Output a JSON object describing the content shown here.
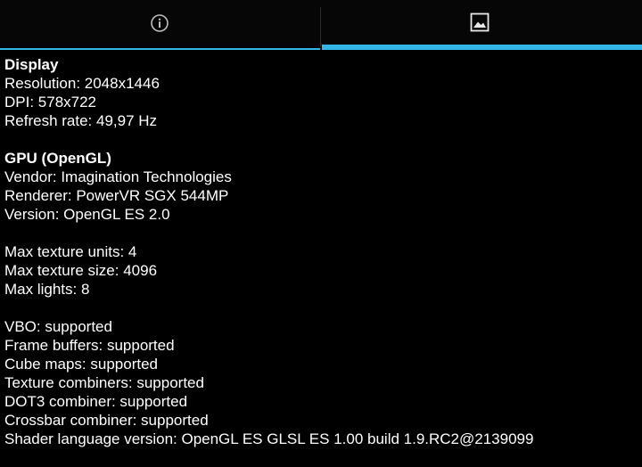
{
  "tabs": [
    {
      "icon": "info-icon"
    },
    {
      "icon": "image-icon"
    }
  ],
  "display": {
    "heading": "Display",
    "resolution": "Resolution: 2048x1446",
    "dpi": "DPI: 578x722",
    "refresh_rate": "Refresh rate: 49,97 Hz"
  },
  "gpu": {
    "heading": "GPU (OpenGL)",
    "vendor": "Vendor: Imagination Technologies",
    "renderer": "Renderer: PowerVR SGX 544MP",
    "version": "Version: OpenGL ES 2.0"
  },
  "limits": {
    "max_texture_units": "Max texture units: 4",
    "max_texture_size": "Max texture size: 4096",
    "max_lights": "Max lights: 8"
  },
  "features": {
    "vbo": "VBO: supported",
    "frame_buffers": "Frame buffers: supported",
    "cube_maps": "Cube maps: supported",
    "texture_combiners": "Texture combiners: supported",
    "dot3_combiner": "DOT3 combiner: supported",
    "crossbar_combiner": "Crossbar combiner: supported",
    "shader_language": "Shader language version: OpenGL ES GLSL ES 1.00 build 1.9.RC2@2139099"
  },
  "colors": {
    "accent": "#33b5e5",
    "background": "#000000",
    "text": "#ffffff"
  }
}
